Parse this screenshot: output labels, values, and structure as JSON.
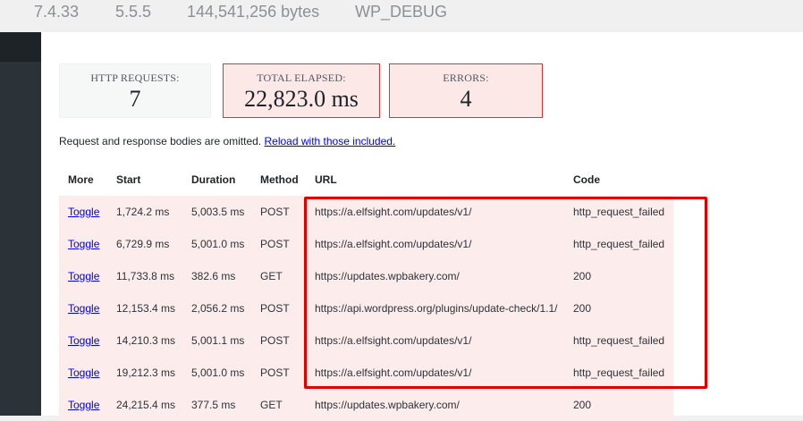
{
  "environment": {
    "php_version": "7.4.33",
    "wp_version": "5.5.5",
    "memory": "144,541,256 bytes",
    "debug": "WP_DEBUG"
  },
  "stats": {
    "http_requests": {
      "label": "HTTP REQUESTS:",
      "value": "7"
    },
    "total_elapsed": {
      "label": "TOTAL ELAPSED:",
      "value": "22,823.0 ms"
    },
    "errors": {
      "label": "ERRORS:",
      "value": "4"
    }
  },
  "notice": {
    "text": "Request and response bodies are omitted.",
    "link": "Reload with those included."
  },
  "table": {
    "headers": {
      "more": "More",
      "start": "Start",
      "duration": "Duration",
      "method": "Method",
      "url": "URL",
      "code": "Code"
    },
    "rows": [
      {
        "more": "Toggle",
        "start": "1,724.2 ms",
        "duration": "5,003.5 ms",
        "method": "POST",
        "url": "https://a.elfsight.com/updates/v1/",
        "code": "http_request_failed"
      },
      {
        "more": "Toggle",
        "start": "6,729.9 ms",
        "duration": "5,001.0 ms",
        "method": "POST",
        "url": "https://a.elfsight.com/updates/v1/",
        "code": "http_request_failed"
      },
      {
        "more": "Toggle",
        "start": "11,733.8 ms",
        "duration": "382.6 ms",
        "method": "GET",
        "url": "https://updates.wpbakery.com/",
        "code": "200"
      },
      {
        "more": "Toggle",
        "start": "12,153.4 ms",
        "duration": "2,056.2 ms",
        "method": "POST",
        "url": "https://api.wordpress.org/plugins/update-check/1.1/",
        "code": "200"
      },
      {
        "more": "Toggle",
        "start": "14,210.3 ms",
        "duration": "5,001.1 ms",
        "method": "POST",
        "url": "https://a.elfsight.com/updates/v1/",
        "code": "http_request_failed"
      },
      {
        "more": "Toggle",
        "start": "19,212.3 ms",
        "duration": "5,001.0 ms",
        "method": "POST",
        "url": "https://a.elfsight.com/updates/v1/",
        "code": "http_request_failed"
      },
      {
        "more": "Toggle",
        "start": "24,215.4 ms",
        "duration": "377.5 ms",
        "method": "GET",
        "url": "https://updates.wpbakery.com/",
        "code": "200"
      }
    ]
  },
  "colors": {
    "error_border": "#d63638",
    "error_fill": "#fde8e8",
    "row_fill": "#fdecec",
    "highlight": "#e00000",
    "sidebar": "#2c3338"
  }
}
